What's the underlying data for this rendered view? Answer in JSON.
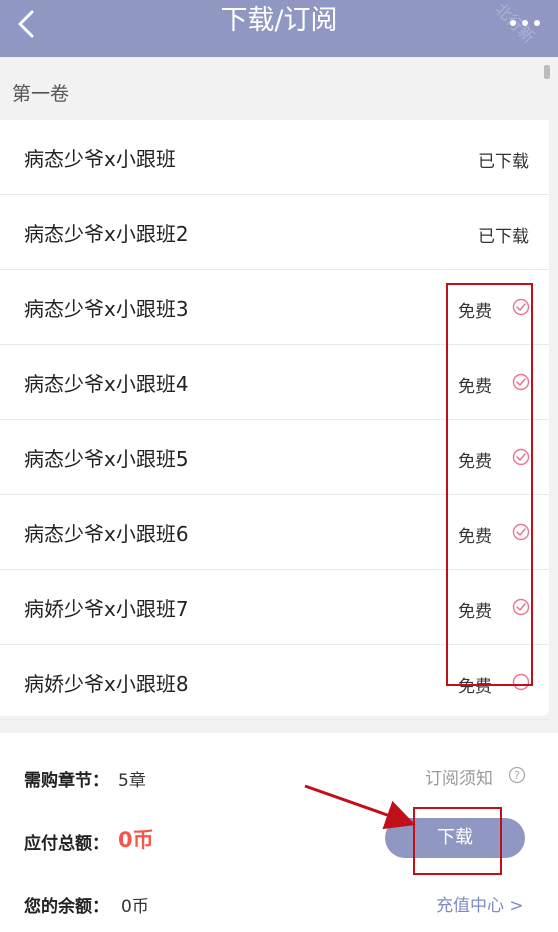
{
  "header": {
    "title": "下载/订阅",
    "back_icon": "chevron-left-icon",
    "more_icon": "more-dots-icon",
    "watermark": "北行新"
  },
  "volume": {
    "title": "第一卷"
  },
  "chapters": [
    {
      "name": "病态少爷x小跟班",
      "status": "已下载"
    },
    {
      "name": "病态少爷x小跟班2",
      "status": "已下载"
    },
    {
      "name": "病态少爷x小跟班3",
      "status": "免费",
      "selected": true
    },
    {
      "name": "病态少爷x小跟班4",
      "status": "免费",
      "selected": true
    },
    {
      "name": "病态少爷x小跟班5",
      "status": "免费",
      "selected": true
    },
    {
      "name": "病态少爷x小跟班6",
      "status": "免费",
      "selected": true
    },
    {
      "name": "病娇少爷x小跟班7",
      "status": "免费",
      "selected": true
    },
    {
      "name": "病娇少爷x小跟班8",
      "status": "免费",
      "selected": false
    }
  ],
  "summary": {
    "need_label": "需购章节：",
    "need_value": "5章",
    "notice_link": "订阅须知",
    "total_label": "应付总额：",
    "total_value": "0币",
    "download_button": "下载",
    "balance_label": "您的余额：",
    "balance_value": "0币",
    "recharge_link": "充值中心 >"
  },
  "colors": {
    "accent": "#9197c3",
    "check": "#e8758e",
    "price": "#f5584a",
    "link": "#7f8bc4",
    "annotation": "#c0101a"
  }
}
